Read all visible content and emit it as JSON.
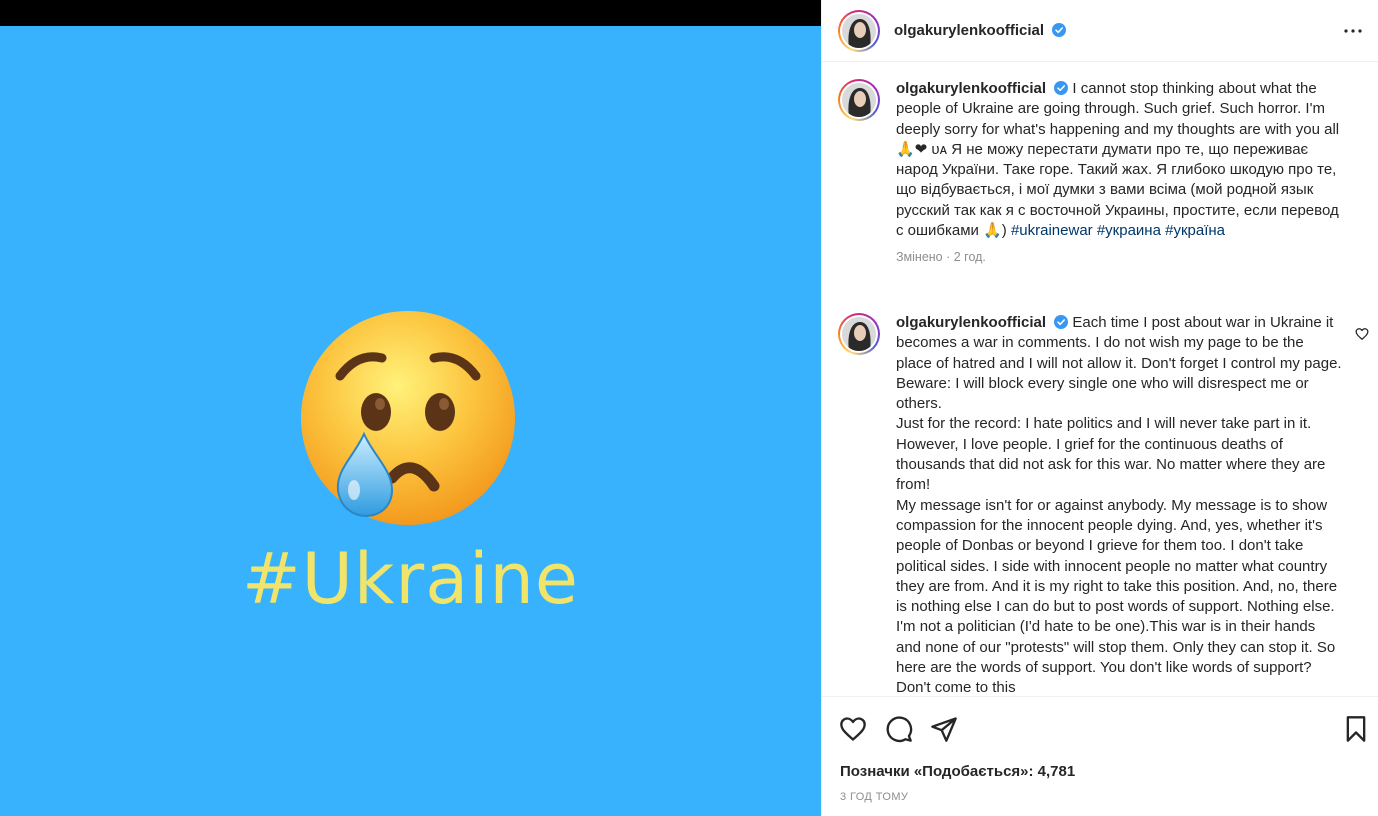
{
  "media": {
    "background_color": "#38b2fd",
    "emoji_icon": "crying-face-emoji",
    "hashtag_text": "#Ukraine",
    "hashtag_color": "#f0e46a"
  },
  "header": {
    "username": "olgakurylenkoofficial",
    "verified_icon": "verified-badge-icon",
    "more_icon": "more-options-icon"
  },
  "caption": {
    "username": "olgakurylenkoofficial",
    "text_before_hashtags": "I cannot stop thinking about what the people of Ukraine are going through. Such grief. Such horror. I'm deeply sorry for what's happening and my thoughts are with you all 🙏❤ ᴜᴀ Я не можу перестати думати про те, що переживає народ України. Таке горе. Такий жах. Я глибоко шкодую про те, що відбувається, і мої думки з вами всіма (мой родной язык русский так как я с восточной Украины, простите, если перевод с ошибками 🙏)",
    "hashtags": [
      "#ukrainewar",
      "#украина",
      "#україна"
    ],
    "meta": "Змінено · 2 год."
  },
  "comment": {
    "username": "olgakurylenkoofficial",
    "text": "Each time I post about war in Ukraine it becomes a war in comments. I do not wish my page to be the place of hatred and I will not allow it. Don't forget I control my page. Beware: I will block every single one who will disrespect me or others.\nJust for the record: I hate politics and I will never take part in it. However, I love people. I grief for the continuous deaths of thousands that did not ask for this war. No matter where they are from!\nMy message isn't for or against anybody. My message is to show compassion for the innocent people dying. And, yes, whether it's people of Donbas or beyond I grieve for them too. I don't take political sides. I side with innocent people no matter what country they are from. And it is my right to take this position. And, no, there is nothing else I can do but to post words of support. Nothing else. I'm not a politician (I'd hate to be one).This war is in their hands and none of our \"protests\" will stop them. Only they can stop it. So here are the words of support. You don't like words of support? Don't come to this",
    "like_icon": "heart-outline-small-icon"
  },
  "actions": {
    "like_icon": "heart-icon",
    "comment_icon": "comment-icon",
    "share_icon": "share-icon",
    "save_icon": "bookmark-icon",
    "likes_label": "Позначки «Подобається»: 4,781",
    "timestamp": "3 ГОД ТОМУ"
  },
  "colors": {
    "hashtag_link": "#00376b",
    "verified_blue": "#3897f0",
    "meta_gray": "#8e8e8e"
  }
}
